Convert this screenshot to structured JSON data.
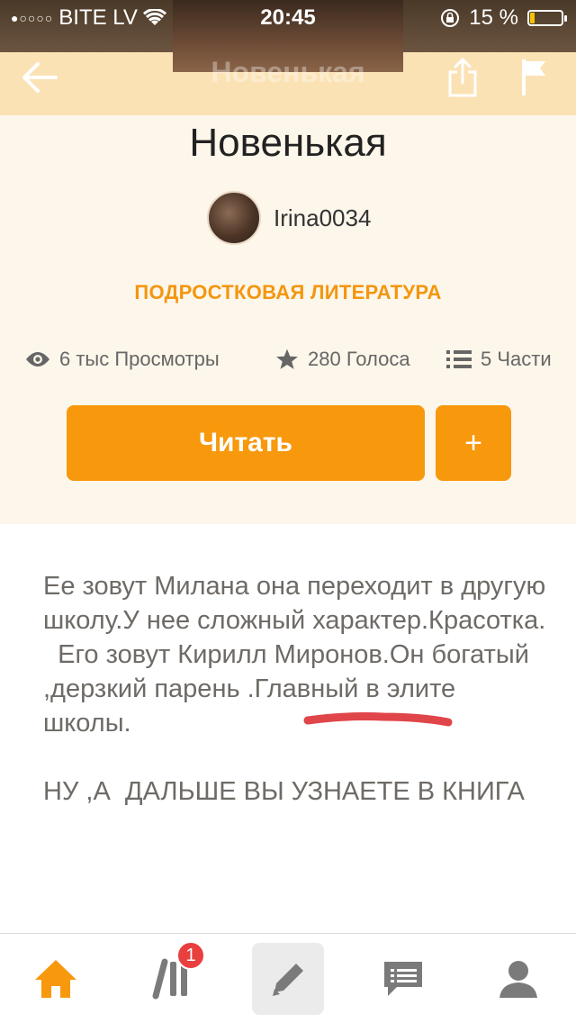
{
  "status_bar": {
    "carrier": "BITE LV",
    "signal_dots": "●○○○○",
    "time": "20:45",
    "battery_percent": "15 %",
    "battery_level": 0.15,
    "battery_color": "#f5c300"
  },
  "nav": {
    "back_icon": "arrow-left-icon",
    "share_icon": "share-icon",
    "report_icon": "flag-icon",
    "faded_title": "Новенькая"
  },
  "story": {
    "title": "Новенькая",
    "author": "Irina0034",
    "category": "ПОДРОСТКОВАЯ ЛИТЕРАТУРА",
    "stats": {
      "views": "6 тыс Просмотры",
      "votes": "280 Голоса",
      "parts": "5 Части"
    },
    "read_button": "Читать",
    "add_button": "+",
    "description": "Ее зовут Милана она переходит в другую школу.У нее сложный характер.Красотка.\n  Его зовут Кирилл Миронов.Он богатый ,дерзкий парень .Главный в элите школы.\n\nНУ ,А  ДАЛЬШЕ ВЫ УЗНАЕТЕ В КНИГА"
  },
  "colors": {
    "accent": "#f7980d",
    "category": "#f4960e",
    "underline_mark": "#e0454a",
    "badge": "#ea3f3f"
  },
  "tabbar": {
    "items": [
      {
        "icon": "home-icon",
        "active": true
      },
      {
        "icon": "library-icon",
        "badge": "1"
      },
      {
        "icon": "pencil-icon"
      },
      {
        "icon": "messages-icon"
      },
      {
        "icon": "profile-icon"
      }
    ]
  }
}
